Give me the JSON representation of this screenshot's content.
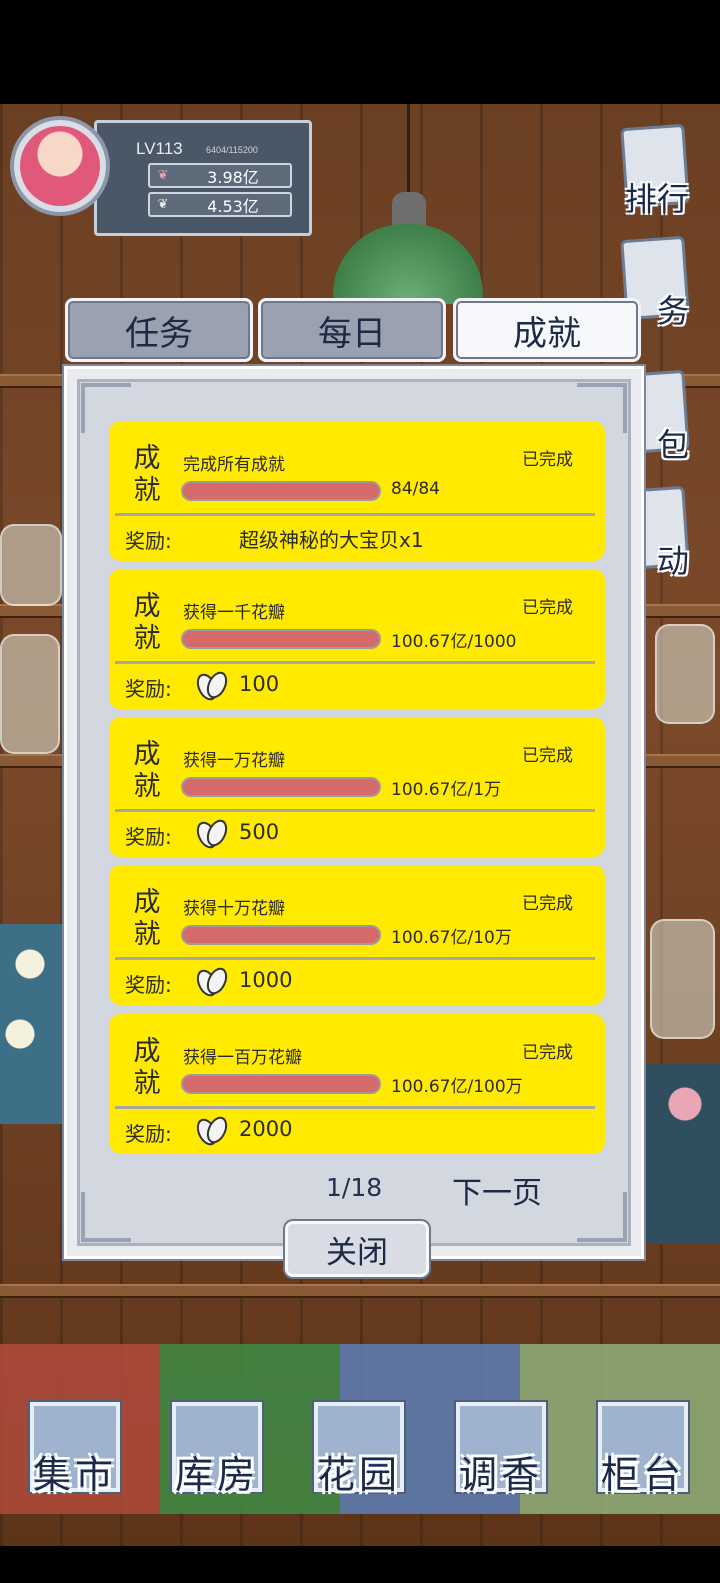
{
  "player": {
    "level": "LV113",
    "exp": "6404/115200",
    "currency1": {
      "icon": "petal-pink-icon",
      "value": "3.98亿"
    },
    "currency2": {
      "icon": "petal-white-icon",
      "value": "4.53亿"
    }
  },
  "side_menu": [
    {
      "label": "排行",
      "icon": "ranking-icon"
    },
    {
      "label": "务",
      "icon": "task-board-icon"
    },
    {
      "label": "包",
      "icon": "bag-icon"
    },
    {
      "label": "动",
      "icon": "event-icon"
    }
  ],
  "tabs": [
    {
      "label": "任务",
      "active": false
    },
    {
      "label": "每日",
      "active": false
    },
    {
      "label": "成就",
      "active": true
    }
  ],
  "achievements": [
    {
      "tag": "成就",
      "title": "完成所有成就",
      "status": "已完成",
      "progress_text": "84/84",
      "progress": 1.0,
      "reward_label": "奖励:",
      "reward_text": "超级神秘的大宝贝x1",
      "reward_value": null
    },
    {
      "tag": "成就",
      "title": "获得一千花瓣",
      "status": "已完成",
      "progress_text": "100.67亿/1000",
      "progress": 1.0,
      "reward_label": "奖励:",
      "reward_text": null,
      "reward_value": "100"
    },
    {
      "tag": "成就",
      "title": "获得一万花瓣",
      "status": "已完成",
      "progress_text": "100.67亿/1万",
      "progress": 1.0,
      "reward_label": "奖励:",
      "reward_text": null,
      "reward_value": "500"
    },
    {
      "tag": "成就",
      "title": "获得十万花瓣",
      "status": "已完成",
      "progress_text": "100.67亿/10万",
      "progress": 1.0,
      "reward_label": "奖励:",
      "reward_text": null,
      "reward_value": "1000"
    },
    {
      "tag": "成就",
      "title": "获得一百万花瓣",
      "status": "已完成",
      "progress_text": "100.67亿/100万",
      "progress": 1.0,
      "reward_label": "奖励:",
      "reward_text": null,
      "reward_value": "2000"
    }
  ],
  "pagination": {
    "page": "1/18",
    "next_label": "下一页"
  },
  "close_label": "关闭",
  "bottom_nav": [
    {
      "label": "集市",
      "icon": "market-icon"
    },
    {
      "label": "库房",
      "icon": "warehouse-icon"
    },
    {
      "label": "花园",
      "icon": "garden-icon"
    },
    {
      "label": "调香",
      "icon": "perfume-icon"
    },
    {
      "label": "柜台",
      "icon": "counter-icon"
    }
  ],
  "colors": {
    "card": "#ffea00",
    "progress_fill": "#d66a6a",
    "tab_active": "#f7f8fb",
    "tab_inactive": "#9aa1b1"
  }
}
